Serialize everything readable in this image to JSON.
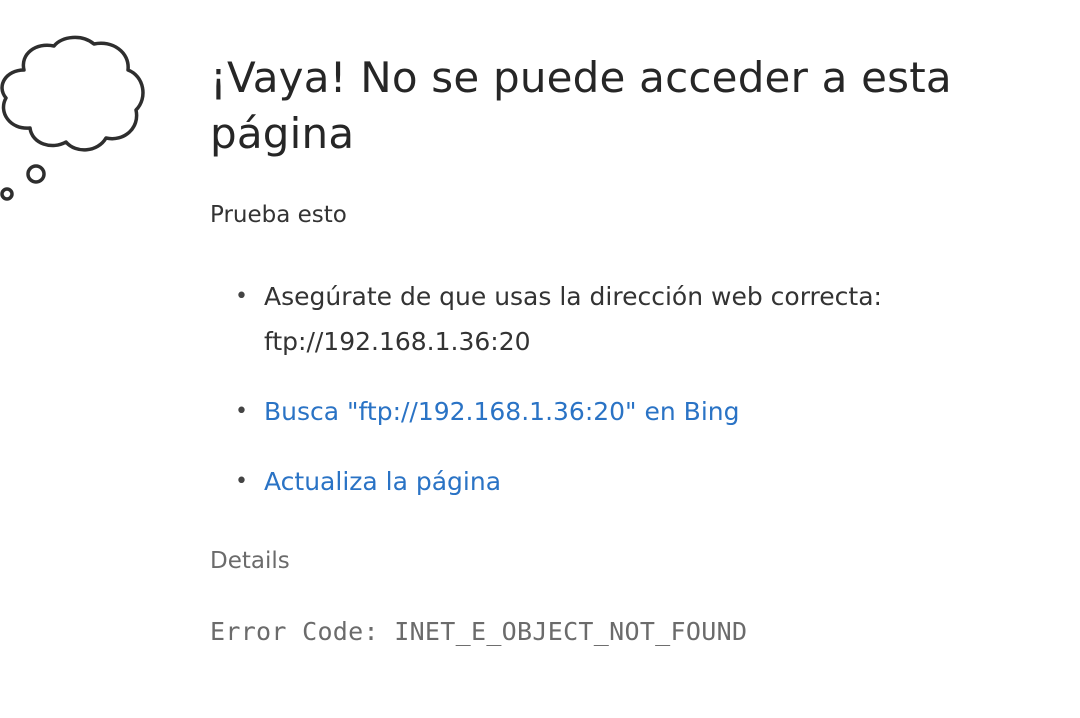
{
  "page": {
    "title": "¡Vaya! No se puede acceder a esta página",
    "icon": "thought-cloud-icon",
    "accent_color": "#2a73c5"
  },
  "try_section": {
    "heading": "Prueba esto",
    "bullet": "•",
    "items": [
      {
        "text": "Asegúrate de que usas la dirección web correcta: ftp://192.168.1.36:20"
      },
      {
        "text": "Busca \"ftp://192.168.1.36:20\" en Bing"
      },
      {
        "text": "Actualiza la página"
      }
    ]
  },
  "details": {
    "heading": "Details",
    "error_code": "Error Code: INET_E_OBJECT_NOT_FOUND"
  }
}
